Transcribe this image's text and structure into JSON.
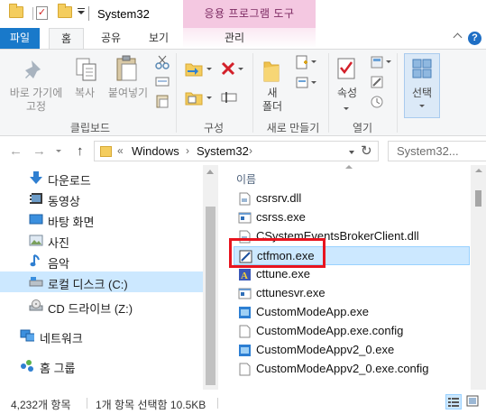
{
  "titlebar": {
    "title": "System32",
    "context_tab": "응용 프로그램 도구"
  },
  "tabs": {
    "file": "파일",
    "home": "홈",
    "share": "공유",
    "view": "보기",
    "manage": "관리"
  },
  "ribbon": {
    "pin_label_1": "바로 가기에",
    "pin_label_2": "고정",
    "copy": "복사",
    "paste": "붙여넣기",
    "clipboard_group": "클립보드",
    "organize_group": "구성",
    "new_folder_1": "새",
    "new_folder_2": "폴더",
    "new_group": "새로 만들기",
    "properties": "속성",
    "open_group": "열기",
    "select": "선택"
  },
  "address": {
    "overflow": "«",
    "crumbs": [
      "Windows",
      "System32"
    ],
    "search_placeholder": "System32..."
  },
  "nav": {
    "items": [
      {
        "label": "다운로드",
        "icon": "download-icon"
      },
      {
        "label": "동영상",
        "icon": "video-icon"
      },
      {
        "label": "바탕 화면",
        "icon": "desktop-icon"
      },
      {
        "label": "사진",
        "icon": "pictures-icon"
      },
      {
        "label": "음악",
        "icon": "music-icon"
      },
      {
        "label": "로컬 디스크 (C:)",
        "icon": "local-disk-icon"
      },
      {
        "label": "CD 드라이브 (Z:)",
        "icon": "cd-drive-icon"
      },
      {
        "label": "네트워크",
        "icon": "network-icon"
      },
      {
        "label": "홈 그룹",
        "icon": "homegroup-icon"
      }
    ]
  },
  "files": {
    "column_name": "이름",
    "rows": [
      {
        "name": "csrsrv.dll",
        "icon": "dll-file-icon"
      },
      {
        "name": "csrss.exe",
        "icon": "exe-file-icon"
      },
      {
        "name": "CSystemEventsBrokerClient.dll",
        "icon": "dll-file-icon"
      },
      {
        "name": "ctfmon.exe",
        "icon": "ctfmon-app-icon",
        "selected": true
      },
      {
        "name": "cttune.exe",
        "icon": "cttune-app-icon"
      },
      {
        "name": "cttunesvr.exe",
        "icon": "exe-file-icon"
      },
      {
        "name": "CustomModeApp.exe",
        "icon": "custom-app-icon"
      },
      {
        "name": "CustomModeApp.exe.config",
        "icon": "config-file-icon"
      },
      {
        "name": "CustomModeAppv2_0.exe",
        "icon": "custom-app-icon"
      },
      {
        "name": "CustomModeAppv2_0.exe.config",
        "icon": "config-file-icon"
      }
    ]
  },
  "status": {
    "item_count": "4,232개 항목",
    "selection": "1개 항목 선택함 10.5KB"
  },
  "colors": {
    "accent": "#1979ca",
    "selection": "#cce8ff",
    "context_tab": "#f4c8e1",
    "highlight_border": "#e8141e"
  }
}
